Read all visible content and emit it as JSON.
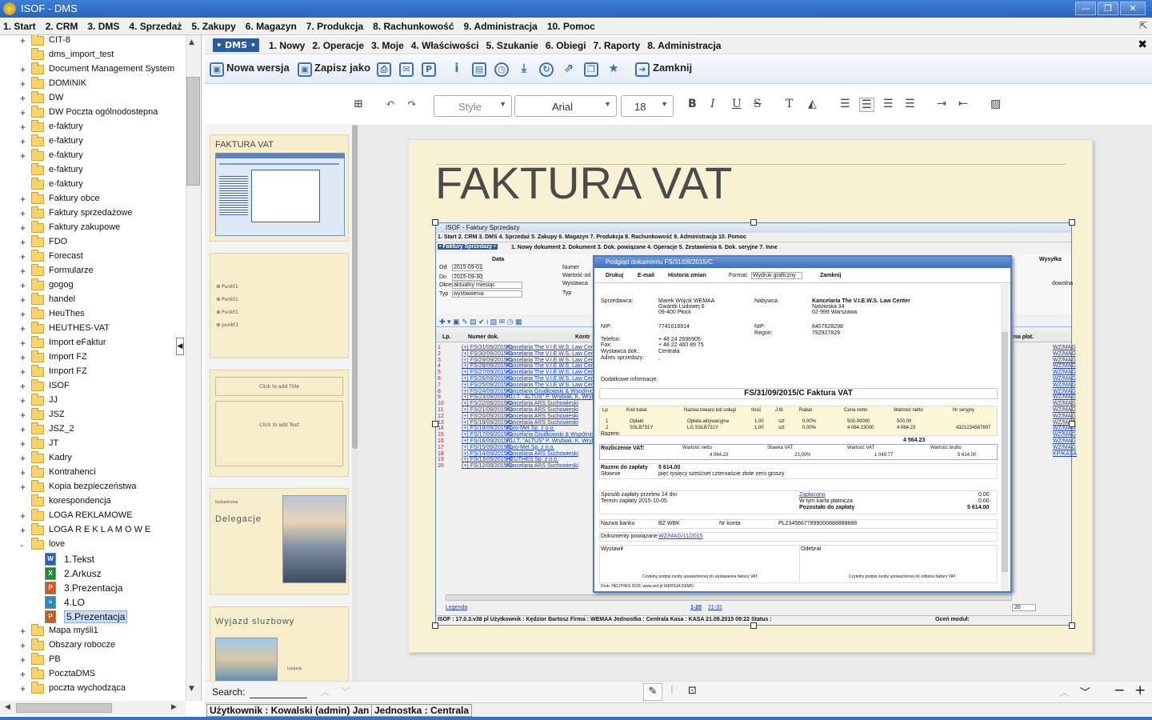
{
  "window": {
    "title": "ISOF - DMS",
    "minimize": "—",
    "maximize": "❐",
    "close": "✕"
  },
  "main_menu": [
    "1. Start",
    "2. CRM",
    "3. DMS",
    "4. Sprzedaż",
    "5. Zakupy",
    "6. Magazyn",
    "7. Produkcja",
    "8. Rachunkowość",
    "9. Administracja",
    "10. Pomoc"
  ],
  "tree": {
    "items": [
      {
        "label": "CIT-8",
        "exp": "+"
      },
      {
        "label": "dms_import_test",
        "exp": ""
      },
      {
        "label": "Document Management System",
        "exp": "+"
      },
      {
        "label": "DOMINIK",
        "exp": "+"
      },
      {
        "label": "DW",
        "exp": "+"
      },
      {
        "label": "DW Poczta ogólnodostepna",
        "exp": "+"
      },
      {
        "label": "e-faktury",
        "exp": "+"
      },
      {
        "label": "e-faktury",
        "exp": "+"
      },
      {
        "label": "e-faktury",
        "exp": "+"
      },
      {
        "label": "e-faktury",
        "exp": ""
      },
      {
        "label": "e-faktury",
        "exp": ""
      },
      {
        "label": "Faktury obce",
        "exp": "+"
      },
      {
        "label": "Faktury sprzedażowe",
        "exp": "+"
      },
      {
        "label": "Faktury zakupowe",
        "exp": "+"
      },
      {
        "label": "FDO",
        "exp": "+"
      },
      {
        "label": "Forecast",
        "exp": "+"
      },
      {
        "label": "Formularze",
        "exp": "+"
      },
      {
        "label": "gogog",
        "exp": "+"
      },
      {
        "label": "handel",
        "exp": "+"
      },
      {
        "label": "HeuThes",
        "exp": "+"
      },
      {
        "label": "HEUTHES-VAT",
        "exp": "+"
      },
      {
        "label": "Import eFaktur",
        "exp": "+"
      },
      {
        "label": "Import FZ",
        "exp": "+"
      },
      {
        "label": "Import FZ",
        "exp": "+"
      },
      {
        "label": "ISOF",
        "exp": "+"
      },
      {
        "label": "JJ",
        "exp": "+"
      },
      {
        "label": "JSZ",
        "exp": "+"
      },
      {
        "label": "JSZ_2",
        "exp": "+"
      },
      {
        "label": "JT",
        "exp": "+"
      },
      {
        "label": "Kadry",
        "exp": "+"
      },
      {
        "label": "Kontrahenci",
        "exp": "+"
      },
      {
        "label": "Kopia bezpieczeństwa",
        "exp": "+"
      },
      {
        "label": "korespondencja",
        "exp": ""
      },
      {
        "label": "LOGA REKLAMOWE",
        "exp": "+"
      },
      {
        "label": "LOGA R E K L A M O W E",
        "exp": "+"
      },
      {
        "label": "love",
        "exp": "-"
      }
    ],
    "love_children": [
      "1.Tekst",
      "2.Arkusz",
      "3.Prezentacja",
      "4.LO",
      "5.Prezentacja"
    ],
    "after": [
      {
        "label": "Mapa myśli1",
        "exp": "+"
      },
      {
        "label": "Obszary robocze",
        "exp": "+"
      },
      {
        "label": "PB",
        "exp": "+"
      },
      {
        "label": "PocztaDMS",
        "exp": "+"
      },
      {
        "label": "poczta wychodząca",
        "exp": "+"
      }
    ]
  },
  "dms_menu": {
    "tag": "• DMS •",
    "items": [
      "1. Nowy",
      "2. Operacje",
      "3. Moje",
      "4. Właściwości",
      "5. Szukanie",
      "6. Obiegi",
      "7. Raporty",
      "8. Administracja"
    ]
  },
  "toolbar": {
    "new_version": "Nowa wersja",
    "save_as": "Zapisz jako",
    "close": "Zamknij"
  },
  "editor": {
    "style": "Style",
    "font": "Arial",
    "size": "18"
  },
  "slides": [
    {
      "title": "FAKTURA VAT"
    },
    {
      "bullets": [
        "Punkt1",
        "Punkt1",
        "Punkt1",
        "punkt1"
      ]
    },
    {
      "title_ph": "Click to add Title",
      "text_ph": "Click to add Text"
    },
    {
      "small": "bajkadrzew",
      "title": "Delegacje"
    },
    {
      "title": "Wyjazd sluzbowy",
      "small": "lujajaja"
    }
  ],
  "page": {
    "title": "FAKTURA VAT"
  },
  "embedded": {
    "app_title": "ISOF - Faktury Sprzedazy",
    "menu": "1. Start   2. CRM   3. DMS   4. Sprzedaż   5. Zakupy   6. Magazyn   7. Produkcja   8. Rachunkowość   9. Administracja   10. Pomoc",
    "submenu_tag": "• Faktury Sprzedazy •",
    "submenu": "1. Nowy dokument   2. Dokument   3. Dok. powiązane   4. Operacje   5. Zestawienia   6. Dok. seryjne   7. Inne",
    "filter": {
      "data": "Data",
      "od_lbl": "Od",
      "od": "2015-09-01",
      "do_lbl": "Do",
      "do": "2015-09-30",
      "okres_lbl": "Okres",
      "okres": "aktualny miesiąc",
      "typ_lbl": "Typ",
      "typ": "wystawienia",
      "numer": "Numer",
      "wartosc": "Wartość od",
      "wystawca": "Wystawca",
      "typ2": "Typ",
      "wysylka": "Wysyłka",
      "dowolna": "dowolna"
    },
    "cols": {
      "lp": "Lp.",
      "nr": "Numer dok.",
      "kontr": "Kontr",
      "platn": "rma płat."
    },
    "rows": [
      [
        "1",
        "(+) FS/31/09/2015/C",
        "Kancelaria The V.I.E.W.S. Law Center"
      ],
      [
        "2",
        "(+) FS/30/09/2015/C",
        "Kancelaria The V.I.E.W.S. Law Center"
      ],
      [
        "3",
        "(+) FS/29/09/2015/C",
        "Kancelaria The V.I.E.W.S. Law Center"
      ],
      [
        "4",
        "(+) FS/28/09/2015/C",
        "Kancelaria The V.I.E.W.S. Law Center"
      ],
      [
        "5",
        "(+) FS/27/09/2015/C",
        "Kancelaria The V.I.E.W.S. Law Center"
      ],
      [
        "6",
        "(+) FS/26/09/2015/C",
        "Kancelaria The V.I.E.W.S. Law Center"
      ],
      [
        "7",
        "(+) FS/25/09/2015/C",
        "Kancelaria The V.I.E.W.S. Law Center"
      ],
      [
        "8",
        "(+) FS/24/09/2015/C",
        "Kancelaria Grudkowski & Wspólnicy"
      ],
      [
        "9",
        "(+) FS/23/09/2015/C",
        "P.U.T. \"ALTUS\" P. Wrybiak, K. Wrybiak"
      ],
      [
        "10",
        "(+) FS/22/09/2015/C",
        "Kancelaria ARS Suchowieski"
      ],
      [
        "11",
        "(+) FS/21/09/2015/C",
        "Kancelaria ARS Suchowieski"
      ],
      [
        "12",
        "(+) FS/20/09/2015/C",
        "Kancelaria ARS Suchowieski"
      ],
      [
        "13",
        "(+) FS/19/09/2015/C",
        "Kancelaria ARS Suchowieski"
      ],
      [
        "14",
        "(+) FS/18/09/2015/C",
        "Euro-Met Sp. z o.o."
      ],
      [
        "15",
        "(+) FS/17/09/2015/C",
        "Kancelaria Grudkowski & Wspólnicy"
      ],
      [
        "16",
        "(+) FS/16/09/2015/C",
        "P.U.T. \"ALTUS\" P. Wrybiak, K. Wrybiak"
      ],
      [
        "17",
        "(+) FS/15/09/2015/C",
        "Euro-Met Sp. z o.o."
      ],
      [
        "18",
        "(+) FS/14/09/2015/C",
        "Kancelaria ARS Suchowieski"
      ],
      [
        "19",
        "(+) FS/13/09/2015/C",
        "HEUTHES Sp. z o.o."
      ],
      [
        "20",
        "(+) FS/12/09/2015/C",
        "Kancelaria ARS Suchowieski"
      ]
    ],
    "right_col": [
      "WZ/MAG",
      "WZ/MAG",
      "WZ/MAG",
      "WZ/MAG",
      "WZ/MAG",
      "WZ/MAG",
      "WZ/MAG",
      "WZ/MAG",
      "WZ/MAG",
      "WZ/MAG",
      "WZ/MAG",
      "WZ/MAG",
      "WZ/MAG",
      "WZ/MAG",
      "WZ/MAG",
      "WZ/MAG",
      "WZ/MAG",
      "KP/KASA"
    ],
    "legend": "Legenda",
    "pages": [
      "1-20",
      "21-31"
    ],
    "page_size": "20",
    "status": "ISOF : 17.0.3.v38 pl   Użytkownik : Kędzior Bartosz   Firma : WEMAA   Jednostka : Centrala   Kasa : KASA   21.09.2015 09:22   Status :",
    "rate": "Oceń moduł:"
  },
  "dialog": {
    "title": "Podgląd dokumentu FS/31/09/2015/C",
    "buttons": [
      "Drukuj",
      "E-mail",
      "Historia zmian"
    ],
    "format_lbl": "Format:",
    "format": "Wydruk graficzny",
    "close": "Zamknij",
    "seller_lbl": "Sprzedawca:",
    "seller": [
      "Marek Wójcik WEMAA",
      "Gwardii Ludowej 6",
      "09-400 Płock"
    ],
    "buyer_lbl": "Nabywca:",
    "buyer": [
      "Kancelaria The V.I.E.W.S. Law Center",
      "Natowska 34",
      "02-999 Warszawa"
    ],
    "nip_lbl": "NIP:",
    "nip": "7741016914",
    "buyer_nip": "8407628298",
    "regon_lbl": "Regon:",
    "regon": "792927829",
    "phone_lbl": "Telefon:",
    "phone": "+ 48 24 2696905",
    "fax_lbl": "Fax:",
    "fax": "+ 48 22 460 89 75",
    "issuer_lbl": "Wystawca dok.:",
    "issuer": "Centrala",
    "addr_lbl": "Adres sprzedaży:",
    "addr": ",",
    "extra_lbl": "Dodatkowe informacje:",
    "invoice_title": "FS/31/09/2015/C Faktura VAT",
    "table_head": [
      "Lp",
      "Kod katal.",
      "Nazwa towaru lub usługi",
      "Ilość",
      "J.M.",
      "Rabat",
      "Cena netto",
      "Wartość netto",
      "Nr seryjny"
    ],
    "table_rows": [
      [
        "1",
        "Opłakt",
        "Opłata aktywacyjna",
        "1.00",
        "szt",
        "0,00%",
        "500.00000",
        "500.00",
        ""
      ],
      [
        "2",
        "SSLB731Y",
        "LG SSLB731Y",
        "1.00",
        "szt",
        "0,00%",
        "4 064.23000",
        "4 064.23",
        "4321234567897"
      ]
    ],
    "razem_lbl": "Razem:",
    "razem": "4 564.23",
    "vat_lbl": "Rozliczenie VAT:",
    "vat_head": [
      "Wartość netto",
      "Stawka VAT",
      "Wartość VAT",
      "Wartość brutto"
    ],
    "vat_row": [
      "4 564.23",
      "23,00%",
      "1 049.77",
      "5 614.00"
    ],
    "total_lbl": "Razem do zapłaty",
    "total": "5 614.00",
    "slownie_lbl": "Słownie",
    "slownie": "pięć tysięcy sześćset czternaście złote zero groszy",
    "payment": [
      "Sposób zapłaty  przelew 14 dni",
      "Termin zapłaty  2015-10-05"
    ],
    "paid": [
      "Zapłacono",
      "W tym karta płatnicza",
      "Pozostało do zapłaty"
    ],
    "paid_vals": [
      "0.00",
      "0.00",
      "5 614.00"
    ],
    "bank": [
      "Nazwa banku",
      "BZ WBK",
      "Nr konta",
      "PL23456677899000888888888"
    ],
    "related_lbl": "Dokumenty powiązane",
    "related": "WZ/MAG/11/2015",
    "issued_lbl": "Wystawił",
    "received_lbl": "Odebrał",
    "sign_left": "Czytelny podpis osoby upoważnionej do wystawienia faktury VAT",
    "sign_right": "Czytelny podpis osoby upoważnionej do odbioru faktury VAT",
    "footer": "Druk: HEUTHES ISOF, www.isof.pl WERSJA DEMO"
  },
  "search": {
    "label": "Search:"
  },
  "status": {
    "user": "Użytkownik : Kowalski (admin) Jan",
    "unit": "Jednostka : Centrala"
  },
  "colors": {
    "accent": "#2d5c9a",
    "titlebar": "#2a64bd",
    "slide_bg": "#f6edcc",
    "link": "#1a3fbd",
    "row_num": "#d01010"
  }
}
